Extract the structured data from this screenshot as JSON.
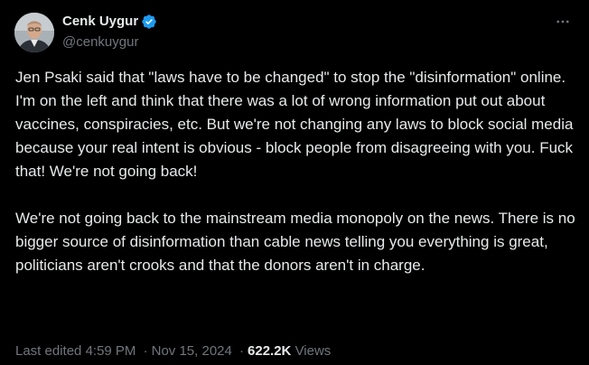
{
  "author": {
    "display_name": "Cenk Uygur",
    "handle": "@cenkuygur",
    "verified": true
  },
  "tweet": {
    "paragraphs": [
      "Jen Psaki said that \"laws have to be changed\" to stop the \"disinformation\" online. I'm on the left and think that there was a lot of wrong information put out about vaccines, conspiracies, etc. But we're not changing any laws to block social media because your real intent is obvious - block people from disagreeing with you. Fuck that! We're not going back!",
      "We're not going back to the mainstream media monopoly on the news. There is no bigger source of disinformation than cable news telling you everything is great, politicians aren't crooks and that the donors aren't in charge."
    ],
    "edited_label": "Last edited",
    "time": "4:59 PM",
    "date": "Nov 15, 2024",
    "separator": "·",
    "views_count": "622.2K",
    "views_label": "Views"
  },
  "icons": {
    "verified": "verified-badge-icon",
    "more": "more-horizontal-icon"
  },
  "colors": {
    "background": "#000000",
    "text_primary": "#e7e9ea",
    "text_secondary": "#71767b",
    "verified_blue": "#1d9bf0"
  }
}
